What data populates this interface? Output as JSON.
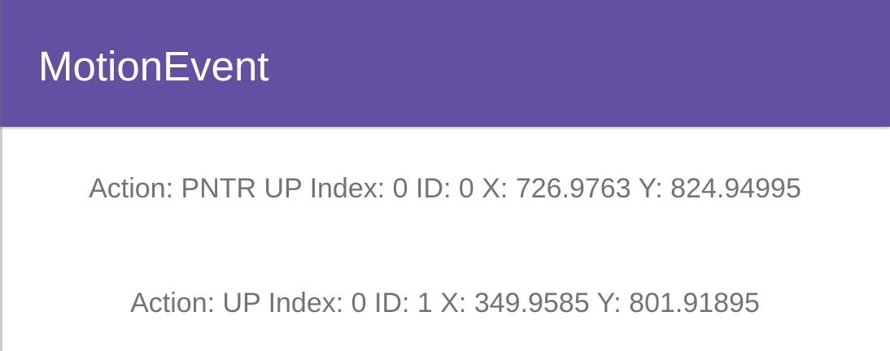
{
  "app_bar": {
    "title": "MotionEvent",
    "color": "#6350a3"
  },
  "events": [
    {
      "text": "Action: PNTR UP Index: 0 ID: 0 X: 726.9763 Y: 824.94995"
    },
    {
      "text": "Action: UP Index: 0 ID: 1 X: 349.9585 Y: 801.91895"
    }
  ]
}
